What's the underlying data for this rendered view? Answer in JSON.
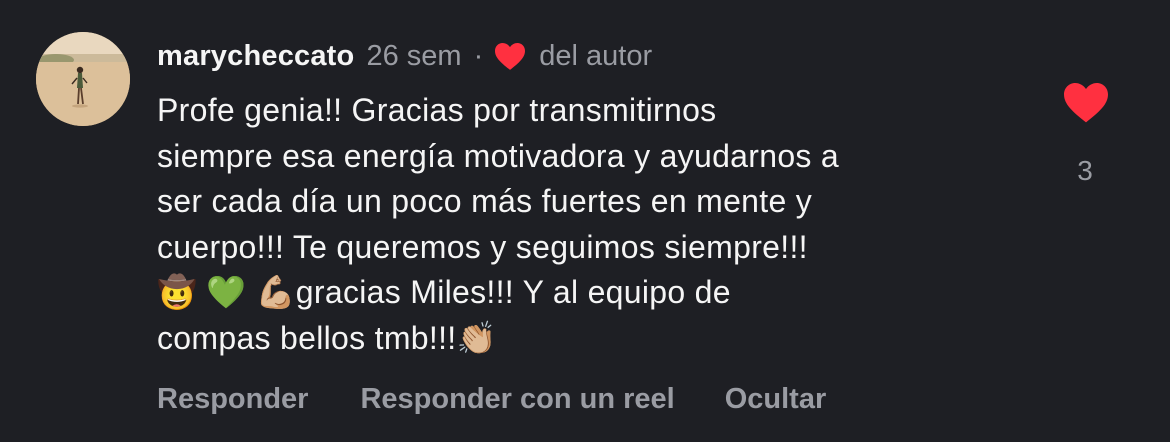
{
  "comment": {
    "username": "marycheccato",
    "time_ago": "26 sem",
    "separator": "·",
    "author_like_label": "del autor",
    "text": "Profe genia!! Gracias por transmitirnos\nsiempre esa energía motivadora y ayudarnos a\nser cada día un poco más fuertes en mente y\ncuerpo!!! Te queremos y seguimos siempre!!!\n🤠 💚 💪🏼gracias Miles!!! Y al equipo de\ncompas bellos tmb!!!👏🏼",
    "like_count": "3",
    "like_icon": "heart-filled-icon",
    "accent_color": "#ff3040"
  },
  "actions": {
    "reply": "Responder",
    "reply_reel": "Responder con un reel",
    "hide": "Ocultar"
  }
}
